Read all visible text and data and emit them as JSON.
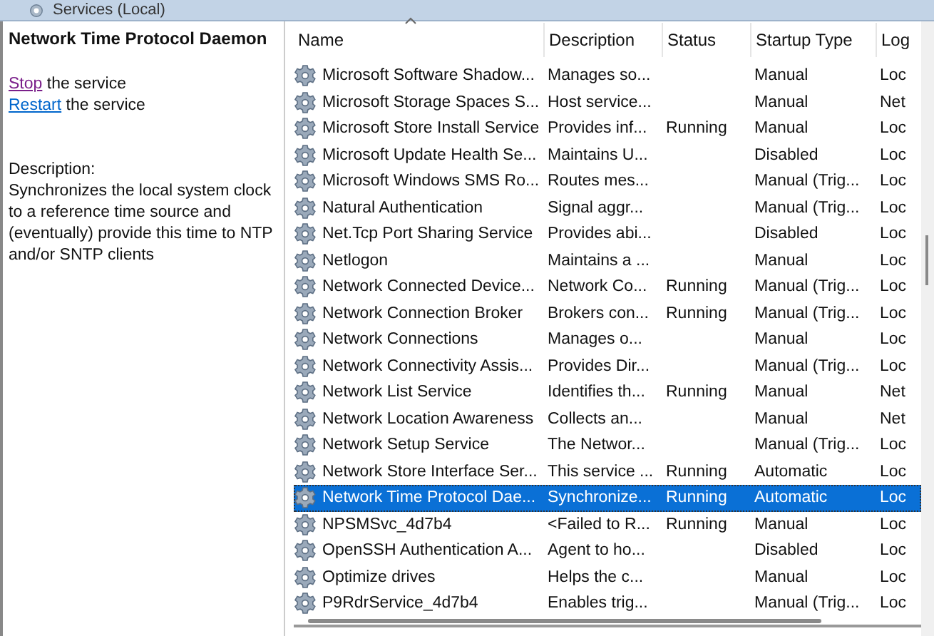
{
  "header": {
    "title": "Services (Local)"
  },
  "detail": {
    "title": "Network Time Protocol Daemon",
    "actions": [
      {
        "link": "Stop",
        "rest": "the service",
        "visited": true
      },
      {
        "link": "Restart",
        "rest": "the service",
        "visited": false
      }
    ],
    "description_label": "Description:",
    "description": "Synchronizes the local system clock to a reference time source and (eventually) provide this time to NTP and/or SNTP clients"
  },
  "table": {
    "columns": [
      "Name",
      "Description",
      "Status",
      "Startup Type",
      "Log"
    ],
    "rows": [
      {
        "name": "Microsoft Software Shadow...",
        "description": "Manages so...",
        "status": "",
        "startup": "Manual",
        "log": "Loc",
        "selected": false
      },
      {
        "name": "Microsoft Storage Spaces S...",
        "description": "Host service...",
        "status": "",
        "startup": "Manual",
        "log": "Net",
        "selected": false
      },
      {
        "name": "Microsoft Store Install Service",
        "description": "Provides inf...",
        "status": "Running",
        "startup": "Manual",
        "log": "Loc",
        "selected": false
      },
      {
        "name": "Microsoft Update Health Se...",
        "description": "Maintains U...",
        "status": "",
        "startup": "Disabled",
        "log": "Loc",
        "selected": false
      },
      {
        "name": "Microsoft Windows SMS Ro...",
        "description": "Routes mes...",
        "status": "",
        "startup": "Manual (Trig...",
        "log": "Loc",
        "selected": false
      },
      {
        "name": "Natural Authentication",
        "description": "Signal aggr...",
        "status": "",
        "startup": "Manual (Trig...",
        "log": "Loc",
        "selected": false
      },
      {
        "name": "Net.Tcp Port Sharing Service",
        "description": "Provides abi...",
        "status": "",
        "startup": "Disabled",
        "log": "Loc",
        "selected": false
      },
      {
        "name": "Netlogon",
        "description": "Maintains a ...",
        "status": "",
        "startup": "Manual",
        "log": "Loc",
        "selected": false
      },
      {
        "name": "Network Connected Device...",
        "description": "Network Co...",
        "status": "Running",
        "startup": "Manual (Trig...",
        "log": "Loc",
        "selected": false
      },
      {
        "name": "Network Connection Broker",
        "description": "Brokers con...",
        "status": "Running",
        "startup": "Manual (Trig...",
        "log": "Loc",
        "selected": false
      },
      {
        "name": "Network Connections",
        "description": "Manages o...",
        "status": "",
        "startup": "Manual",
        "log": "Loc",
        "selected": false
      },
      {
        "name": "Network Connectivity Assis...",
        "description": "Provides Dir...",
        "status": "",
        "startup": "Manual (Trig...",
        "log": "Loc",
        "selected": false
      },
      {
        "name": "Network List Service",
        "description": "Identifies th...",
        "status": "Running",
        "startup": "Manual",
        "log": "Net",
        "selected": false
      },
      {
        "name": "Network Location Awareness",
        "description": "Collects an...",
        "status": "",
        "startup": "Manual",
        "log": "Net",
        "selected": false
      },
      {
        "name": "Network Setup Service",
        "description": "The Networ...",
        "status": "",
        "startup": "Manual (Trig...",
        "log": "Loc",
        "selected": false
      },
      {
        "name": "Network Store Interface Ser...",
        "description": "This service ...",
        "status": "Running",
        "startup": "Automatic",
        "log": "Loc",
        "selected": false
      },
      {
        "name": "Network Time Protocol Dae...",
        "description": "Synchronize...",
        "status": "Running",
        "startup": "Automatic",
        "log": "Loc",
        "selected": true
      },
      {
        "name": "NPSMSvc_4d7b4",
        "description": "<Failed to R...",
        "status": "Running",
        "startup": "Manual",
        "log": "Loc",
        "selected": false
      },
      {
        "name": "OpenSSH Authentication A...",
        "description": "Agent to ho...",
        "status": "",
        "startup": "Disabled",
        "log": "Loc",
        "selected": false
      },
      {
        "name": "Optimize drives",
        "description": "Helps the c...",
        "status": "",
        "startup": "Manual",
        "log": "Loc",
        "selected": false
      },
      {
        "name": "P9RdrService_4d7b4",
        "description": "Enables trig...",
        "status": "",
        "startup": "Manual (Trig...",
        "log": "Loc",
        "selected": false
      }
    ]
  }
}
